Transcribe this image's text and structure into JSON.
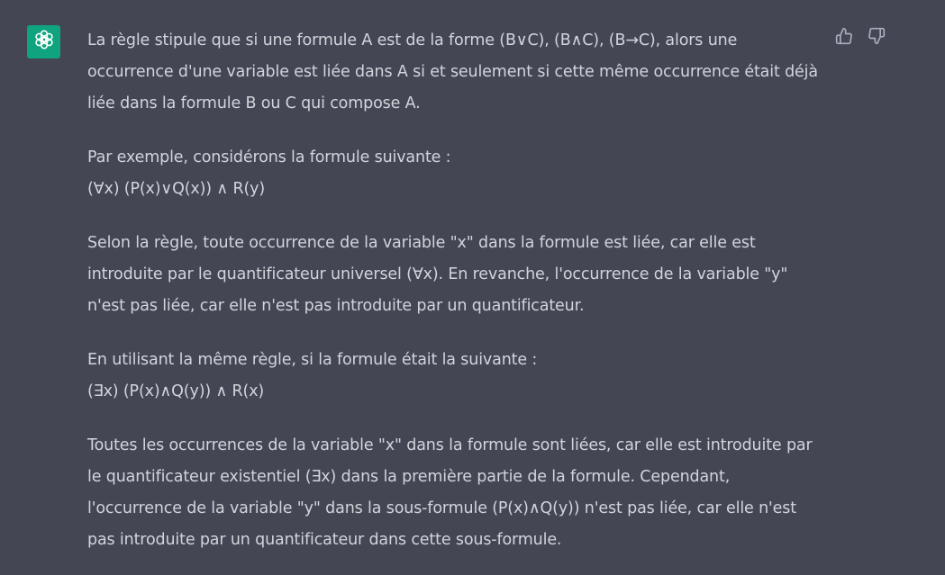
{
  "assistant": {
    "avatar_icon": "openai-logo-icon",
    "brand_color": "#10a37f"
  },
  "feedback": {
    "thumbs_up_icon": "thumbs-up-icon",
    "thumbs_down_icon": "thumbs-down-icon"
  },
  "message": {
    "paragraphs": [
      {
        "lines": [
          "La règle stipule que si une formule A est de la forme (B∨C), (B∧C), (B→C), alors une",
          "occurrence d'une variable est liée dans A si et seulement si cette même occurrence était déjà",
          "liée dans la formule B ou C qui compose A."
        ]
      },
      {
        "lines": [
          "Par exemple, considérons la formule suivante :",
          "(∀x) (P(x)∨Q(x)) ∧ R(y)"
        ]
      },
      {
        "lines": [
          "Selon la règle, toute occurrence de la variable \"x\" dans la formule est liée, car elle est",
          "introduite par le quantificateur universel (∀x). En revanche, l'occurrence de la variable \"y\"",
          "n'est pas liée, car elle n'est pas introduite par un quantificateur."
        ]
      },
      {
        "lines": [
          "En utilisant la même règle, si la formule était la suivante :",
          "(∃x) (P(x)∧Q(y)) ∧ R(x)"
        ]
      },
      {
        "lines": [
          "Toutes les occurrences de la variable \"x\" dans la formule sont liées, car elle est introduite par",
          "le quantificateur existentiel (∃x) dans la première partie de la formule. Cependant,",
          "l'occurrence de la variable \"y\" dans la sous-formule (P(x)∧Q(y)) n'est pas liée, car elle n'est",
          "pas introduite par un quantificateur dans cette sous-formule."
        ]
      }
    ]
  }
}
